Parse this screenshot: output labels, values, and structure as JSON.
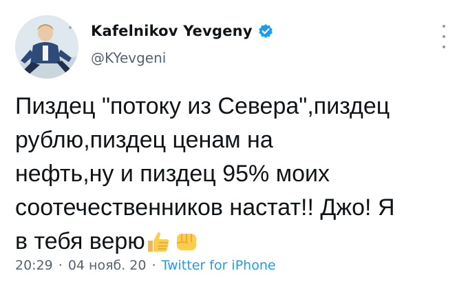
{
  "tweet": {
    "author": {
      "display_name": "Kafelnikov Yevgeny",
      "handle": "@KYevgeni",
      "verified": true,
      "avatar_icon": "avatar-photo-icon"
    },
    "text_lines": [
      "Пиздец \"потоку из Севера\",пиздец",
      "рублю,пиздец ценам на",
      "нефть,ну и пиздец 95% моих",
      "соотечественников настат!! Джо! Я",
      "в тебя верю"
    ],
    "emojis": [
      "thumbs-up-icon",
      "raised-fist-icon"
    ],
    "time": "20:29",
    "separator": "·",
    "date": "04 нояб. 20",
    "source": "Twitter for iPhone",
    "colors": {
      "link": "#1d9bf0",
      "secondary": "#536471",
      "text": "#0f1419"
    }
  }
}
